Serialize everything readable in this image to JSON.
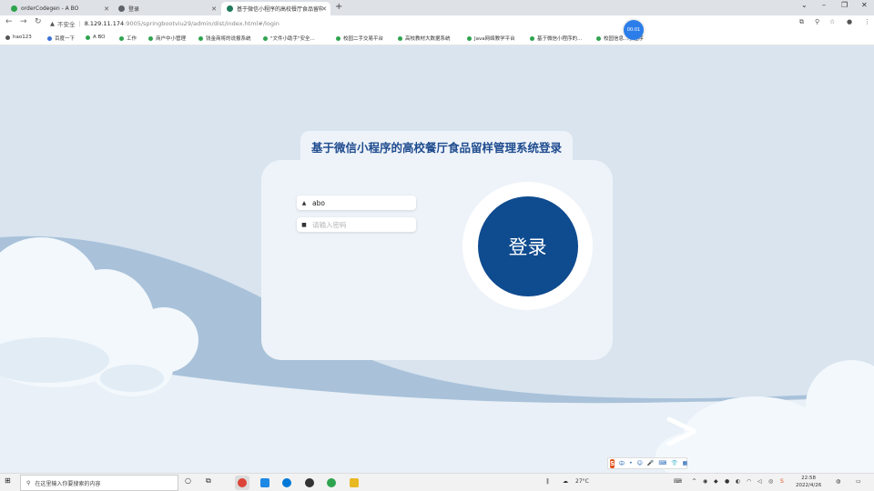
{
  "browser": {
    "tabs": [
      {
        "label": "orderCodegen - A BO",
        "color": "#2ea44f",
        "active": false
      },
      {
        "label": "登录",
        "color": "#5f6368",
        "active": false
      },
      {
        "label": "基于微信小程序的高校餐厅食品留样管理系统登录",
        "color": "#1f7a5a",
        "active": true
      }
    ],
    "address": {
      "security_label": "不安全",
      "host": "8.129.11.174",
      "path": ":9005/springbootviu29/admin/dist/index.html#/login"
    },
    "bookmarks": [
      "hao123",
      "百度一下",
      "A BO",
      "工作",
      "商户中小管理",
      "钱金商将的说报系统",
      "\"文件小助手\"安全...",
      "校园二手交易平台",
      "高校教材大数据系统",
      "Java网络教学平台",
      "基于微信小程序的...",
      "校园信息...小程序"
    ],
    "timer_badge": "00:01"
  },
  "login": {
    "title": "基于微信小程序的高校餐厅食品留样管理系统登录",
    "username_value": "abo",
    "password_placeholder": "请输入密码",
    "submit_label": "登录"
  },
  "ime": {
    "items": [
      "中",
      "•",
      "☺",
      "🎤",
      "⌨",
      "👕",
      "▦"
    ]
  },
  "taskbar": {
    "search_placeholder": "在这里输入你要搜索的内容",
    "weather": "27°C",
    "time": "22:58",
    "date": "2022/4/26"
  },
  "colors": {
    "accent": "#0f4b8f",
    "title": "#1f4c8f",
    "card": "#eef3f9",
    "page_bg": "#d9e4ef"
  }
}
